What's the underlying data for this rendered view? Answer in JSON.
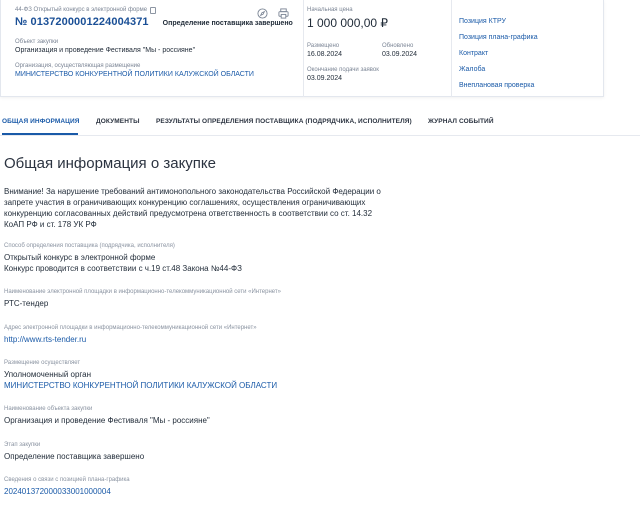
{
  "header": {
    "procurement_type": "44-ФЗ Открытый конкурс в электронной форме",
    "number": "№ 0137200001224004371",
    "status": "Определение поставщика завершено",
    "object_label": "Объект закупки",
    "object_value": "Организация и проведение Фестиваля \"Мы - россияне\"",
    "org_label": "Организация, осуществляющая размещение",
    "org_value": "МИНИСТЕРСТВО КОНКУРЕНТНОЙ ПОЛИТИКИ КАЛУЖСКОЙ ОБЛАСТИ",
    "price_label": "Начальная цена",
    "price_value": "1 000 000,00 ₽",
    "posted_label": "Размещено",
    "posted_value": "16.08.2024",
    "updated_label": "Обновлено",
    "updated_value": "03.09.2024",
    "deadline_label": "Окончание подачи заявок",
    "deadline_value": "03.09.2024",
    "icons": [
      "copy-icon",
      "compass-icon",
      "print-icon"
    ]
  },
  "side_links": [
    "Позиция КТРУ",
    "Позиция плана-графика",
    "Контракт",
    "Жалоба",
    "Внеплановая проверка"
  ],
  "tabs": [
    "ОБЩАЯ ИНФОРМАЦИЯ",
    "ДОКУМЕНТЫ",
    "РЕЗУЛЬТАТЫ ОПРЕДЕЛЕНИЯ ПОСТАВЩИКА (ПОДРЯДЧИКА, ИСПОЛНИТЕЛЯ)",
    "ЖУРНАЛ СОБЫТИЙ"
  ],
  "main": {
    "title": "Общая информация о закупке",
    "warning": "Внимание! За нарушение требований антимонопольного законодательства Российской Федерации о запрете участия в ограничивающих конкуренцию соглашениях, осуществления ограничивающих конкуренцию согласованных действий предусмотрена ответственность в соответствии со ст. 14.32 КоАП РФ и ст. 178 УК РФ",
    "sections": [
      {
        "label": "Способ определения поставщика (подрядчика, исполнителя)",
        "value": "Открытый конкурс в электронной форме",
        "value2": "Конкурс проводится в соответствии с ч.19 ст.48 Закона №44-ФЗ"
      },
      {
        "label": "Наименование электронной площадки в информационно-телекоммуникационной сети «Интернет»",
        "value": "РТС-тендер"
      },
      {
        "label": "Адрес электронной площадки в информационно-телекоммуникационной сети «Интернет»",
        "value": "http://www.rts-tender.ru"
      },
      {
        "label": "Размещение осуществляет",
        "value": "Уполномоченный орган",
        "value2": "МИНИСТЕРСТВО КОНКУРЕНТНОЙ ПОЛИТИКИ КАЛУЖСКОЙ ОБЛАСТИ"
      },
      {
        "label": "Наименование объекта закупки",
        "value": "Организация и проведение Фестиваля \"Мы - россияне\""
      },
      {
        "label": "Этап закупки",
        "value": "Определение поставщика завершено"
      },
      {
        "label": "Сведения о связи с позицией плана-графика",
        "value": "202401372000033001000004"
      }
    ]
  },
  "colors": {
    "link": "#1a5aa8",
    "accent": "#1a4f96",
    "text": "#1f2a37",
    "muted": "#7b8595"
  }
}
